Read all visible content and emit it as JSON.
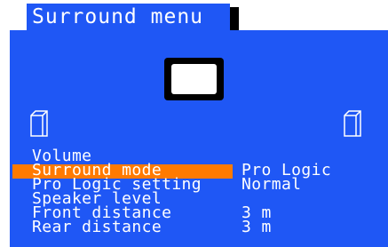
{
  "window": {
    "title": "Surround menu"
  },
  "icons": {
    "tv": "tv-icon",
    "speaker_left": "speaker-icon",
    "speaker_right": "speaker-icon"
  },
  "colors": {
    "panel_blue": "#1f57f5",
    "highlight_orange": "#ff7a00",
    "text_white": "#ffffff"
  },
  "menu": {
    "items": [
      {
        "label": "Volume",
        "value": ""
      },
      {
        "label": "Surround mode",
        "value": "Pro Logic",
        "selected": true
      },
      {
        "label": "Pro Logic setting",
        "value": "Normal"
      },
      {
        "label": "Speaker level",
        "value": ""
      },
      {
        "label": "Front distance",
        "value": "3 m"
      },
      {
        "label": "Rear distance",
        "value": "3 m"
      }
    ]
  }
}
